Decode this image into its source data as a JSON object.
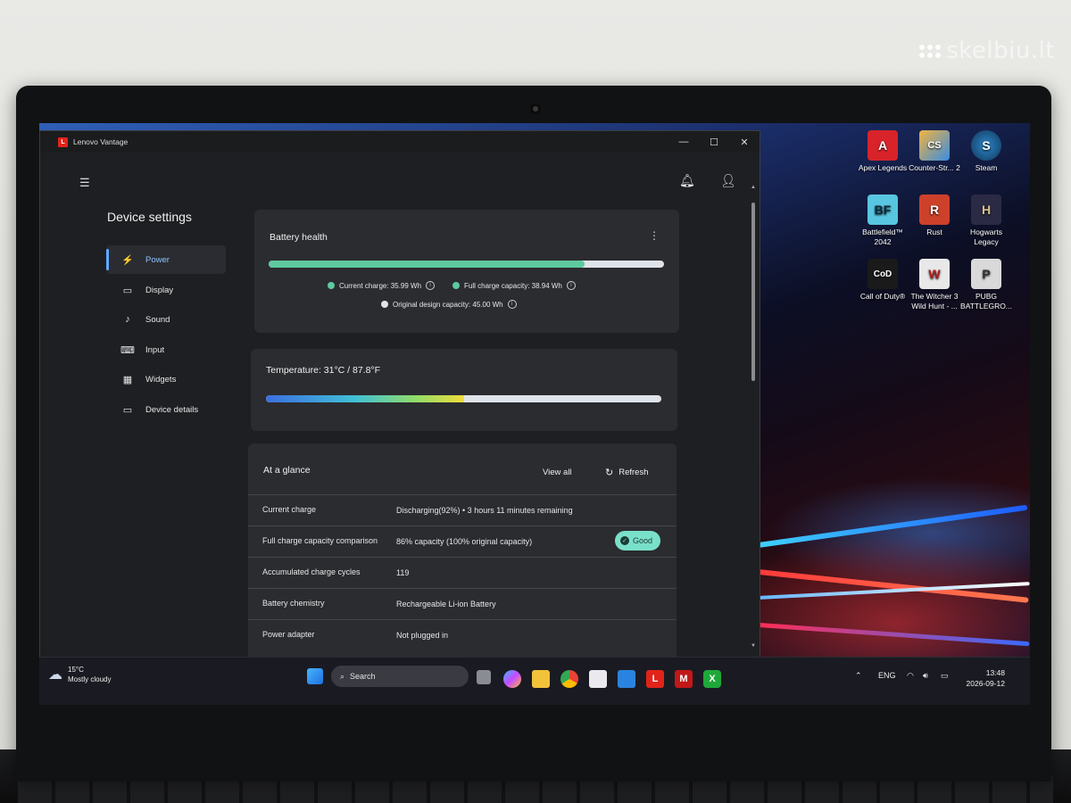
{
  "watermark": "skelbiu.lt",
  "desktop": {
    "icons": [
      {
        "label": "Apex Legends",
        "glyph": "A",
        "color": "#d8232a"
      },
      {
        "label": "Counter-Str... 2",
        "glyph": "CS",
        "color": "#e39b2d"
      },
      {
        "label": "Steam",
        "glyph": "S",
        "color": "#1b4d7a"
      },
      {
        "label": "Battlefield™ 2042",
        "glyph": "BF",
        "color": "#58c6e0"
      },
      {
        "label": "Rust",
        "glyph": "R",
        "color": "#cd412b"
      },
      {
        "label": "Hogwarts Legacy",
        "glyph": "H",
        "color": "#2b2a44"
      },
      {
        "label": "Call of Duty®",
        "glyph": "CoD",
        "color": "#1a1a1a"
      },
      {
        "label": "The Witcher 3 Wild Hunt - ...",
        "glyph": "W",
        "color": "#e0e0e0"
      },
      {
        "label": "PUBG BATTLEGRO...",
        "glyph": "P",
        "color": "#e0e0e0"
      }
    ]
  },
  "app": {
    "title": "Lenovo Vantage",
    "logo_letter": "L",
    "controls": {
      "minimize": "—",
      "maximize": "☐",
      "close": "✕"
    },
    "sidebar": {
      "title": "Device settings",
      "items": [
        {
          "label": "Power",
          "icon": "plug-icon",
          "glyph": "⚡"
        },
        {
          "label": "Display",
          "icon": "monitor-icon",
          "glyph": "▭"
        },
        {
          "label": "Sound",
          "icon": "music-note-icon",
          "glyph": "♪"
        },
        {
          "label": "Input",
          "icon": "keyboard-icon",
          "glyph": "⌨"
        },
        {
          "label": "Widgets",
          "icon": "widgets-icon",
          "glyph": "▦"
        },
        {
          "label": "Device details",
          "icon": "laptop-icon",
          "glyph": "▭"
        }
      ]
    },
    "battery_health": {
      "title": "Battery health",
      "menu_glyph": "⋮",
      "charge_fraction": 0.8,
      "current_charge": "Current charge:  35.99 Wh",
      "full_charge_capacity": "Full charge capacity:  38.94 Wh",
      "original_design_capacity": "Original design capacity:  45.00 Wh",
      "colors": {
        "current": "#5ec9a0",
        "full": "#5ec9a0",
        "design": "#dfe3ea"
      }
    },
    "temperature": {
      "label": "Temperature:  31°C / 87.8°F",
      "level_fraction": 0.5
    },
    "at_a_glance": {
      "title": "At a glance",
      "view_all": "View all",
      "refresh": "Refresh",
      "rows": [
        {
          "key": "Current charge",
          "value": "Discharging(92%)  •  3 hours 11 minutes remaining"
        },
        {
          "key": "Full charge capacity comparison",
          "value": "86% capacity (100% original capacity)",
          "badge": "Good"
        },
        {
          "key": "Accumulated charge cycles",
          "value": "119"
        },
        {
          "key": "Battery chemistry",
          "value": "Rechargeable Li-ion Battery"
        },
        {
          "key": "Power adapter",
          "value": "Not plugged in"
        }
      ]
    }
  },
  "taskbar": {
    "weather_temp": "15°C",
    "weather_desc": "Mostly cloudy",
    "search_placeholder": "Search",
    "language": "ENG",
    "time": "13:48",
    "date": "2026-09-12"
  }
}
